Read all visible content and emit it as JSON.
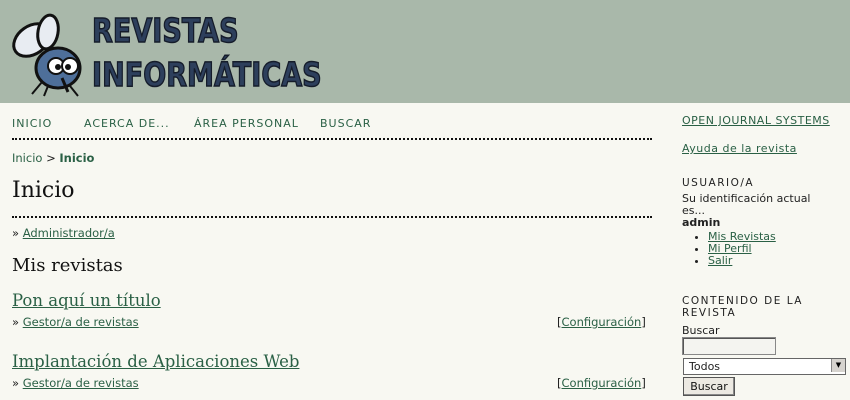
{
  "header": {
    "logo_line1": "REVISTAS",
    "logo_line2": "INFORMÁTICAS"
  },
  "nav": {
    "items": [
      "INICIO",
      "ACERCA DE...",
      "ÁREA PERSONAL",
      "BUSCAR"
    ]
  },
  "breadcrumb": {
    "home": "Inicio",
    "separator": ">",
    "current": "Inicio"
  },
  "main": {
    "title": "Inicio",
    "admin_role": "Administrador/a",
    "bullet": "»",
    "my_journals_heading": "Mis revistas",
    "journals": [
      {
        "title": "Pon aquí un título",
        "role": "Gestor/a de revistas",
        "config": "Configuración"
      },
      {
        "title": "Implantación de Aplicaciones Web",
        "role": "Gestor/a de revistas",
        "config": "Configuración"
      }
    ]
  },
  "sidebar": {
    "ojs_link": "OPEN JOURNAL SYSTEMS",
    "help_link": "Ayuda de la revista",
    "user_heading": "USUARIO/A",
    "user_desc": "Su identificación actual es...",
    "username": "admin",
    "user_links": [
      "Mis Revistas",
      "Mi Perfil",
      "Salir"
    ],
    "content_heading": "CONTENIDO DE LA REVISTA",
    "search_label": "Buscar",
    "search_value": "",
    "search_scope": "Todos",
    "search_button": "Buscar"
  },
  "colors": {
    "header_bg": "#a9b8aa",
    "page_bg": "#f8f8f2",
    "link": "#2a6045",
    "logo_text": "#2d3f5c"
  }
}
